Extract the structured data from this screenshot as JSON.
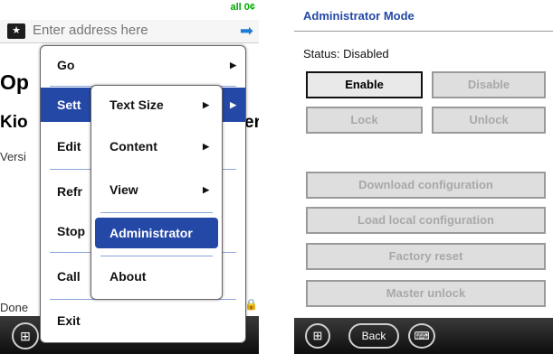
{
  "left_screen": {
    "signal_text": "all 0¢",
    "address_placeholder": "Enter address here",
    "go_arrow": "➡",
    "background": {
      "heading_partial": "Op",
      "subheading_partial": "Kio",
      "subheading_tail": "er",
      "version_partial": "Versi",
      "done_partial": "Done"
    },
    "main_menu": [
      "Go",
      "Sett",
      "Edit",
      "Refr",
      "Stop",
      "Call",
      "Exit"
    ],
    "sub_menu": [
      "Text Size",
      "Content",
      "View",
      "Administrator",
      "About"
    ],
    "colors": {
      "highlight": "#2448a6",
      "menu_sep": "#8aa4d8"
    }
  },
  "right_screen": {
    "title": "Administrator Mode",
    "status": "Status: Disabled",
    "buttons": {
      "enable": "Enable",
      "disable": "Disable",
      "lock": "Lock",
      "unlock": "Unlock",
      "download": "Download configuration",
      "load_local": "Load local configuration",
      "factory_reset": "Factory reset",
      "master_unlock": "Master unlock"
    },
    "back": "Back"
  }
}
